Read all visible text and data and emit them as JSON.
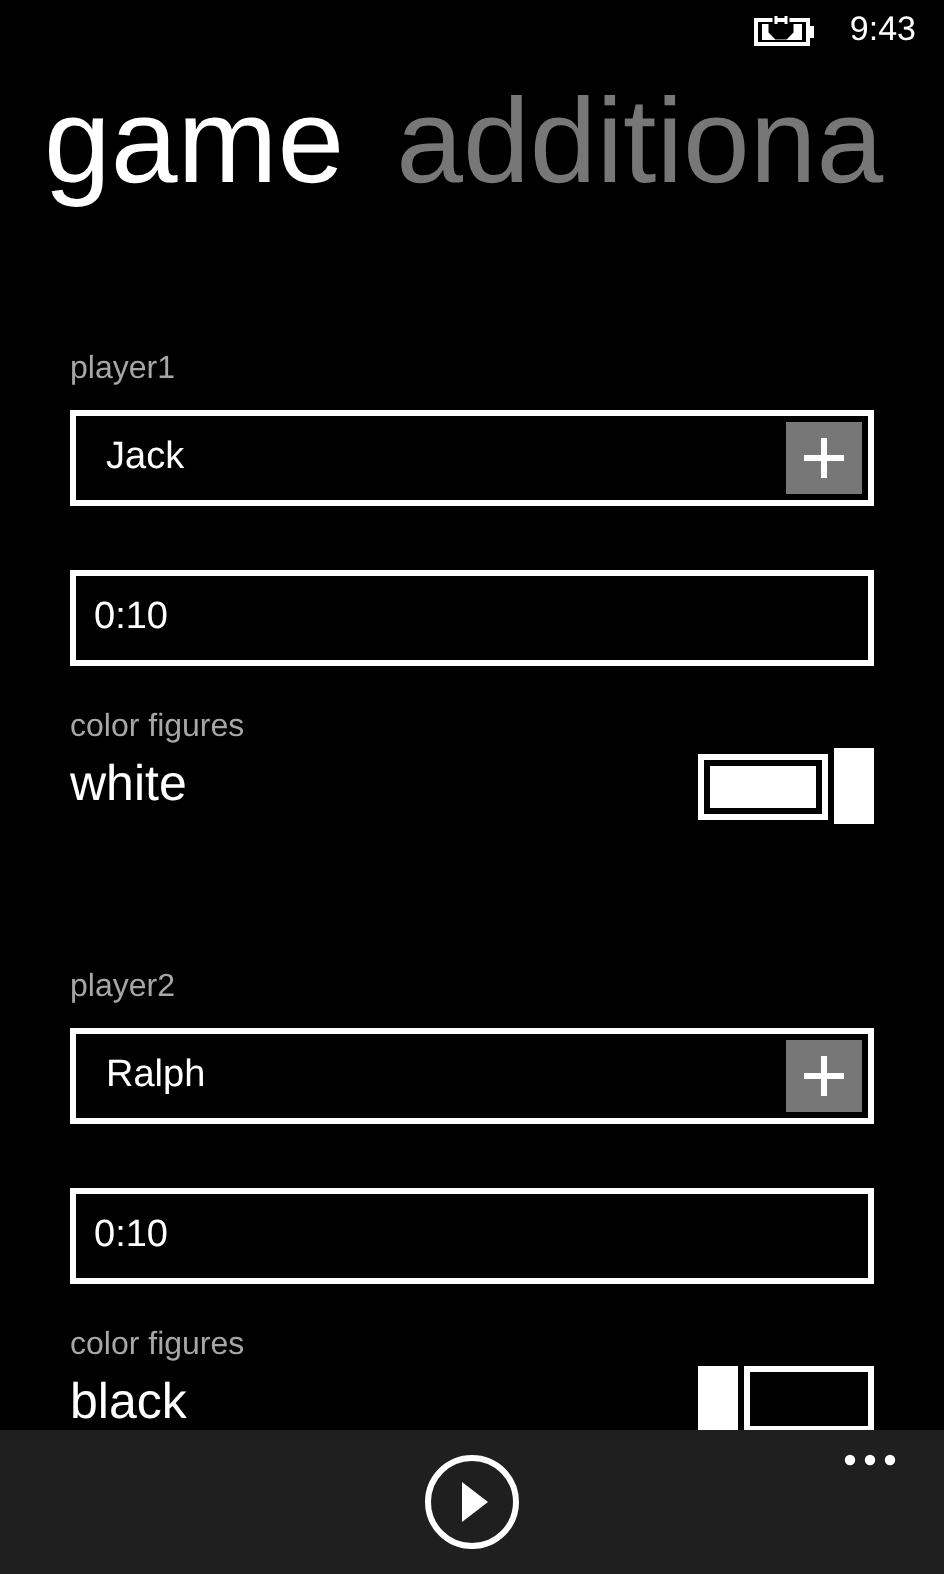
{
  "status_bar": {
    "time": "9:43"
  },
  "pivot": [
    {
      "label": "game",
      "selected": true
    },
    {
      "label": "additiona",
      "selected": false
    }
  ],
  "players": [
    {
      "label": "player1",
      "name": "Jack",
      "time": "0:10",
      "color_label": "color figures",
      "color_value": "white",
      "on": true
    },
    {
      "label": "player2",
      "name": "Ralph",
      "time": "0:10",
      "color_label": "color figures",
      "color_value": "black",
      "on": false
    }
  ]
}
